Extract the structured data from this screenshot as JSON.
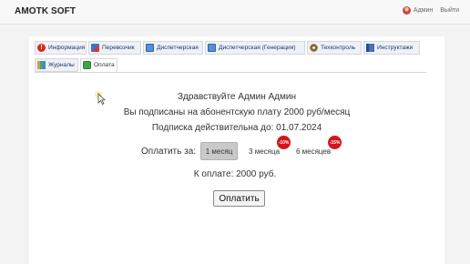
{
  "header": {
    "brand": "AMOTK SOFT",
    "user_name": "Админ",
    "logout_label": "Выйти"
  },
  "tabs": [
    {
      "label": "Информация",
      "icon": "info-icon"
    },
    {
      "label": "Перевозчик",
      "icon": "truck-icon"
    },
    {
      "label": "Диспетчерская",
      "icon": "document-icon"
    },
    {
      "label": "Диспетчерская (Генерация)",
      "icon": "document-icon"
    },
    {
      "label": "Техконтроль",
      "icon": "gear-icon"
    },
    {
      "label": "Инструктажи",
      "icon": "book-icon"
    },
    {
      "label": "Журналы",
      "icon": "journal-icon"
    },
    {
      "label": "Оплата",
      "icon": "payment-icon",
      "active": true
    }
  ],
  "payment": {
    "greeting": "Здравствуйте Админ Админ",
    "subscription": "Вы подписаны на абонентскую плату 2000 руб/месяц",
    "valid_until": "Подписка действительна до: 01.07.2024",
    "pay_for_label": "Оплатить за:",
    "options": [
      {
        "label": "1 месяц",
        "selected": true,
        "discount": ""
      },
      {
        "label": "3 месяца",
        "selected": false,
        "discount": "-10%"
      },
      {
        "label": "6 месяцев",
        "selected": false,
        "discount": "-15%"
      }
    ],
    "total": "К оплате: 2000 руб.",
    "pay_button": "Оплатить"
  },
  "colors": {
    "badge": "#d5141b",
    "tab_text": "#1a3a6e",
    "selected_option": "#c9c9c9"
  }
}
